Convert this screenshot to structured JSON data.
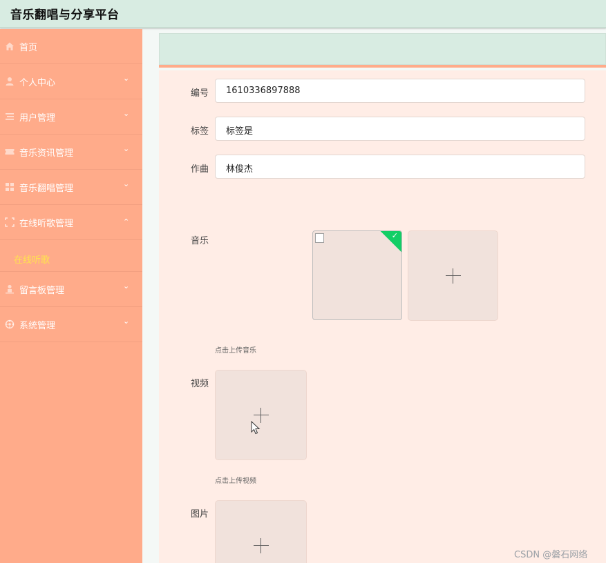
{
  "header": {
    "title": "音乐翻唱与分享平台"
  },
  "sidebar": {
    "items": [
      {
        "label": "首页",
        "icon": "home-icon",
        "has_chevron": false
      },
      {
        "label": "个人中心",
        "icon": "user-icon",
        "has_chevron": true
      },
      {
        "label": "用户管理",
        "icon": "list-icon",
        "has_chevron": true
      },
      {
        "label": "音乐资讯管理",
        "icon": "ticket-icon",
        "has_chevron": true
      },
      {
        "label": "音乐翻唱管理",
        "icon": "grid-icon",
        "has_chevron": true
      },
      {
        "label": "在线听歌管理",
        "icon": "frame-icon",
        "has_chevron": true,
        "expanded": true
      },
      {
        "label": "留言板管理",
        "icon": "person-stand-icon",
        "has_chevron": true
      },
      {
        "label": "系统管理",
        "icon": "cog-icon",
        "has_chevron": true
      }
    ],
    "active_submenu": {
      "label": "在线听歌",
      "color": "#ffe34d"
    },
    "chevron_down": "⌄",
    "chevron_up": "⌃"
  },
  "form": {
    "fields": {
      "number": {
        "label": "编号",
        "value": "1610336897888"
      },
      "tags": {
        "label": "标签",
        "value": "标签是"
      },
      "composer": {
        "label": "作曲",
        "value": "林俊杰"
      }
    },
    "music": {
      "label": "音乐",
      "tip": "点击上传音乐",
      "uploaded": true,
      "check": "✓"
    },
    "video": {
      "label": "视频",
      "tip": "点击上传视频"
    },
    "image": {
      "label": "图片"
    }
  },
  "watermark": "CSDN @磐石网络",
  "colors": {
    "sidebar_bg": "#ffab8a",
    "header_bg": "#d8ece2",
    "form_bg": "#ffede6",
    "success_badge": "#13ce66"
  }
}
